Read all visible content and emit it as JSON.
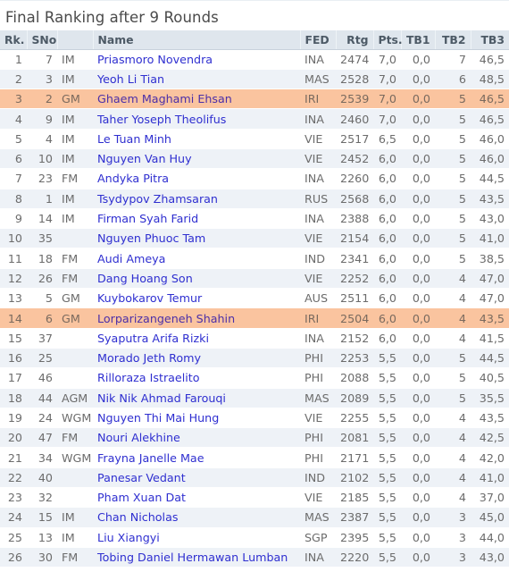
{
  "window": {
    "title": "Final Ranking after 9 Rounds"
  },
  "table": {
    "columns": [
      {
        "key": "rk",
        "label": "Rk."
      },
      {
        "key": "sno",
        "label": "SNo"
      },
      {
        "key": "ttl",
        "label": ""
      },
      {
        "key": "name",
        "label": "Name"
      },
      {
        "key": "fed",
        "label": "FED"
      },
      {
        "key": "rtg",
        "label": "Rtg"
      },
      {
        "key": "pts",
        "label": "Pts."
      },
      {
        "key": "tb1",
        "label": "TB1"
      },
      {
        "key": "tb2",
        "label": "TB2"
      },
      {
        "key": "tb3",
        "label": "TB3"
      }
    ],
    "highlight_color": "#fac49f",
    "link_color": "#2f2fd0",
    "header_bg": "#dfe6ed",
    "alt_row_bg": "#eef2f7",
    "rows": [
      {
        "rk": "1",
        "sno": "7",
        "ttl": "IM",
        "name": "Priasmoro Novendra",
        "fed": "INA",
        "rtg": "2474",
        "pts": "7,0",
        "tb1": "0,0",
        "tb2": "7",
        "tb3": "46,5",
        "highlighted": false
      },
      {
        "rk": "2",
        "sno": "3",
        "ttl": "IM",
        "name": "Yeoh Li Tian",
        "fed": "MAS",
        "rtg": "2528",
        "pts": "7,0",
        "tb1": "0,0",
        "tb2": "6",
        "tb3": "48,5",
        "highlighted": false
      },
      {
        "rk": "3",
        "sno": "2",
        "ttl": "GM",
        "name": "Ghaem Maghami Ehsan",
        "fed": "IRI",
        "rtg": "2539",
        "pts": "7,0",
        "tb1": "0,0",
        "tb2": "5",
        "tb3": "46,5",
        "highlighted": true
      },
      {
        "rk": "4",
        "sno": "9",
        "ttl": "IM",
        "name": "Taher Yoseph Theolifus",
        "fed": "INA",
        "rtg": "2460",
        "pts": "7,0",
        "tb1": "0,0",
        "tb2": "5",
        "tb3": "46,5",
        "highlighted": false
      },
      {
        "rk": "5",
        "sno": "4",
        "ttl": "IM",
        "name": "Le Tuan Minh",
        "fed": "VIE",
        "rtg": "2517",
        "pts": "6,5",
        "tb1": "0,0",
        "tb2": "5",
        "tb3": "46,0",
        "highlighted": false
      },
      {
        "rk": "6",
        "sno": "10",
        "ttl": "IM",
        "name": "Nguyen Van Huy",
        "fed": "VIE",
        "rtg": "2452",
        "pts": "6,0",
        "tb1": "0,0",
        "tb2": "5",
        "tb3": "46,0",
        "highlighted": false
      },
      {
        "rk": "7",
        "sno": "23",
        "ttl": "FM",
        "name": "Andyka Pitra",
        "fed": "INA",
        "rtg": "2260",
        "pts": "6,0",
        "tb1": "0,0",
        "tb2": "5",
        "tb3": "44,5",
        "highlighted": false
      },
      {
        "rk": "8",
        "sno": "1",
        "ttl": "IM",
        "name": "Tsydypov Zhamsaran",
        "fed": "RUS",
        "rtg": "2568",
        "pts": "6,0",
        "tb1": "0,0",
        "tb2": "5",
        "tb3": "43,5",
        "highlighted": false
      },
      {
        "rk": "9",
        "sno": "14",
        "ttl": "IM",
        "name": "Firman Syah Farid",
        "fed": "INA",
        "rtg": "2388",
        "pts": "6,0",
        "tb1": "0,0",
        "tb2": "5",
        "tb3": "43,0",
        "highlighted": false
      },
      {
        "rk": "10",
        "sno": "35",
        "ttl": "",
        "name": "Nguyen Phuoc Tam",
        "fed": "VIE",
        "rtg": "2154",
        "pts": "6,0",
        "tb1": "0,0",
        "tb2": "5",
        "tb3": "41,0",
        "highlighted": false
      },
      {
        "rk": "11",
        "sno": "18",
        "ttl": "FM",
        "name": "Audi Ameya",
        "fed": "IND",
        "rtg": "2341",
        "pts": "6,0",
        "tb1": "0,0",
        "tb2": "5",
        "tb3": "38,5",
        "highlighted": false
      },
      {
        "rk": "12",
        "sno": "26",
        "ttl": "FM",
        "name": "Dang Hoang Son",
        "fed": "VIE",
        "rtg": "2252",
        "pts": "6,0",
        "tb1": "0,0",
        "tb2": "4",
        "tb3": "47,0",
        "highlighted": false
      },
      {
        "rk": "13",
        "sno": "5",
        "ttl": "GM",
        "name": "Kuybokarov Temur",
        "fed": "AUS",
        "rtg": "2511",
        "pts": "6,0",
        "tb1": "0,0",
        "tb2": "4",
        "tb3": "47,0",
        "highlighted": false
      },
      {
        "rk": "14",
        "sno": "6",
        "ttl": "GM",
        "name": "Lorparizangeneh Shahin",
        "fed": "IRI",
        "rtg": "2504",
        "pts": "6,0",
        "tb1": "0,0",
        "tb2": "4",
        "tb3": "43,5",
        "highlighted": true
      },
      {
        "rk": "15",
        "sno": "37",
        "ttl": "",
        "name": "Syaputra Arifa Rizki",
        "fed": "INA",
        "rtg": "2152",
        "pts": "6,0",
        "tb1": "0,0",
        "tb2": "4",
        "tb3": "41,5",
        "highlighted": false
      },
      {
        "rk": "16",
        "sno": "25",
        "ttl": "",
        "name": "Morado Jeth Romy",
        "fed": "PHI",
        "rtg": "2253",
        "pts": "5,5",
        "tb1": "0,0",
        "tb2": "5",
        "tb3": "44,5",
        "highlighted": false
      },
      {
        "rk": "17",
        "sno": "46",
        "ttl": "",
        "name": "Rilloraza Istraelito",
        "fed": "PHI",
        "rtg": "2088",
        "pts": "5,5",
        "tb1": "0,0",
        "tb2": "5",
        "tb3": "40,5",
        "highlighted": false
      },
      {
        "rk": "18",
        "sno": "44",
        "ttl": "AGM",
        "name": "Nik Nik Ahmad Farouqi",
        "fed": "MAS",
        "rtg": "2089",
        "pts": "5,5",
        "tb1": "0,0",
        "tb2": "5",
        "tb3": "35,5",
        "highlighted": false
      },
      {
        "rk": "19",
        "sno": "24",
        "ttl": "WGM",
        "name": "Nguyen Thi Mai Hung",
        "fed": "VIE",
        "rtg": "2255",
        "pts": "5,5",
        "tb1": "0,0",
        "tb2": "4",
        "tb3": "43,5",
        "highlighted": false
      },
      {
        "rk": "20",
        "sno": "47",
        "ttl": "FM",
        "name": "Nouri Alekhine",
        "fed": "PHI",
        "rtg": "2081",
        "pts": "5,5",
        "tb1": "0,0",
        "tb2": "4",
        "tb3": "42,5",
        "highlighted": false
      },
      {
        "rk": "21",
        "sno": "34",
        "ttl": "WGM",
        "name": "Frayna Janelle Mae",
        "fed": "PHI",
        "rtg": "2171",
        "pts": "5,5",
        "tb1": "0,0",
        "tb2": "4",
        "tb3": "42,0",
        "highlighted": false
      },
      {
        "rk": "22",
        "sno": "40",
        "ttl": "",
        "name": "Panesar Vedant",
        "fed": "IND",
        "rtg": "2102",
        "pts": "5,5",
        "tb1": "0,0",
        "tb2": "4",
        "tb3": "41,0",
        "highlighted": false
      },
      {
        "rk": "23",
        "sno": "32",
        "ttl": "",
        "name": "Pham Xuan Dat",
        "fed": "VIE",
        "rtg": "2185",
        "pts": "5,5",
        "tb1": "0,0",
        "tb2": "4",
        "tb3": "37,0",
        "highlighted": false
      },
      {
        "rk": "24",
        "sno": "15",
        "ttl": "IM",
        "name": "Chan Nicholas",
        "fed": "MAS",
        "rtg": "2387",
        "pts": "5,5",
        "tb1": "0,0",
        "tb2": "3",
        "tb3": "45,0",
        "highlighted": false
      },
      {
        "rk": "25",
        "sno": "13",
        "ttl": "IM",
        "name": "Liu Xiangyi",
        "fed": "SGP",
        "rtg": "2395",
        "pts": "5,5",
        "tb1": "0,0",
        "tb2": "3",
        "tb3": "44,0",
        "highlighted": false
      },
      {
        "rk": "26",
        "sno": "30",
        "ttl": "FM",
        "name": "Tobing Daniel Hermawan Lumban",
        "fed": "INA",
        "rtg": "2220",
        "pts": "5,5",
        "tb1": "0,0",
        "tb2": "3",
        "tb3": "43,0",
        "highlighted": false
      }
    ]
  }
}
